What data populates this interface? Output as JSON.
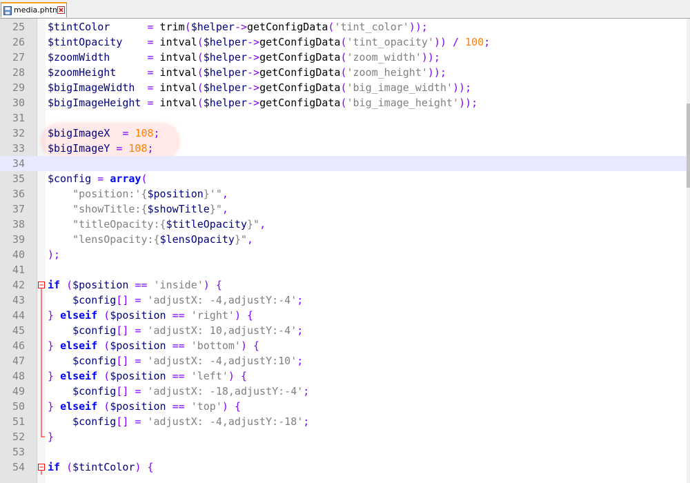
{
  "tab": {
    "filename": "media.phtml",
    "close_icon": "close-x-icon",
    "file_icon": "save-file-icon",
    "accent": "#f4a020"
  },
  "colors": {
    "variable": "#000080",
    "operator": "#8000ff",
    "number": "#ff8000",
    "string": "#808080",
    "keyword": "#0000ff",
    "current_line": "#e8e8ff",
    "gutter": "#e4e4e4",
    "fold_marker": "#ff0000"
  },
  "editor": {
    "current_line_number": "34",
    "lines": [
      {
        "n": "25",
        "tokens": [
          [
            "var",
            "$tintColor"
          ],
          [
            "fn",
            "      "
          ],
          [
            "op",
            "="
          ],
          [
            "fn",
            " trim"
          ],
          [
            "par",
            "("
          ],
          [
            "var",
            "$helper"
          ],
          [
            "op",
            "->"
          ],
          [
            "fn",
            "getConfigData"
          ],
          [
            "par",
            "("
          ],
          [
            "str",
            "'tint_color'"
          ],
          [
            "par",
            "));"
          ]
        ]
      },
      {
        "n": "26",
        "tokens": [
          [
            "var",
            "$tintOpacity"
          ],
          [
            "fn",
            "    "
          ],
          [
            "op",
            "="
          ],
          [
            "fn",
            " intval"
          ],
          [
            "par",
            "("
          ],
          [
            "var",
            "$helper"
          ],
          [
            "op",
            "->"
          ],
          [
            "fn",
            "getConfigData"
          ],
          [
            "par",
            "("
          ],
          [
            "str",
            "'tint_opacity'"
          ],
          [
            "par",
            "))"
          ],
          [
            "fn",
            " "
          ],
          [
            "op",
            "/"
          ],
          [
            "fn",
            " "
          ],
          [
            "num",
            "100"
          ],
          [
            "par",
            ";"
          ]
        ]
      },
      {
        "n": "27",
        "tokens": [
          [
            "var",
            "$zoomWidth"
          ],
          [
            "fn",
            "      "
          ],
          [
            "op",
            "="
          ],
          [
            "fn",
            " intval"
          ],
          [
            "par",
            "("
          ],
          [
            "var",
            "$helper"
          ],
          [
            "op",
            "->"
          ],
          [
            "fn",
            "getConfigData"
          ],
          [
            "par",
            "("
          ],
          [
            "str",
            "'zoom_width'"
          ],
          [
            "par",
            "));"
          ]
        ]
      },
      {
        "n": "28",
        "tokens": [
          [
            "var",
            "$zoomHeight"
          ],
          [
            "fn",
            "     "
          ],
          [
            "op",
            "="
          ],
          [
            "fn",
            " intval"
          ],
          [
            "par",
            "("
          ],
          [
            "var",
            "$helper"
          ],
          [
            "op",
            "->"
          ],
          [
            "fn",
            "getConfigData"
          ],
          [
            "par",
            "("
          ],
          [
            "str",
            "'zoom_height'"
          ],
          [
            "par",
            "));"
          ]
        ]
      },
      {
        "n": "29",
        "tokens": [
          [
            "var",
            "$bigImageWidth"
          ],
          [
            "fn",
            "  "
          ],
          [
            "op",
            "="
          ],
          [
            "fn",
            " intval"
          ],
          [
            "par",
            "("
          ],
          [
            "var",
            "$helper"
          ],
          [
            "op",
            "->"
          ],
          [
            "fn",
            "getConfigData"
          ],
          [
            "par",
            "("
          ],
          [
            "str",
            "'big_image_width'"
          ],
          [
            "par",
            "));"
          ]
        ]
      },
      {
        "n": "30",
        "tokens": [
          [
            "var",
            "$bigImageHeight"
          ],
          [
            "fn",
            " "
          ],
          [
            "op",
            "="
          ],
          [
            "fn",
            " intval"
          ],
          [
            "par",
            "("
          ],
          [
            "var",
            "$helper"
          ],
          [
            "op",
            "->"
          ],
          [
            "fn",
            "getConfigData"
          ],
          [
            "par",
            "("
          ],
          [
            "str",
            "'big_image_height'"
          ],
          [
            "par",
            "));"
          ]
        ]
      },
      {
        "n": "31",
        "tokens": []
      },
      {
        "n": "32",
        "tokens": [
          [
            "var",
            "$bigImageX"
          ],
          [
            "fn",
            "  "
          ],
          [
            "op",
            "="
          ],
          [
            "fn",
            " "
          ],
          [
            "num",
            "108"
          ],
          [
            "par",
            ";"
          ]
        ]
      },
      {
        "n": "33",
        "tokens": [
          [
            "var",
            "$bigImageY"
          ],
          [
            "fn",
            " "
          ],
          [
            "op",
            "="
          ],
          [
            "fn",
            " "
          ],
          [
            "num",
            "108"
          ],
          [
            "par",
            ";"
          ]
        ]
      },
      {
        "n": "34",
        "tokens": []
      },
      {
        "n": "35",
        "tokens": [
          [
            "var",
            "$config"
          ],
          [
            "fn",
            " "
          ],
          [
            "op",
            "="
          ],
          [
            "fn",
            " "
          ],
          [
            "kw",
            "array"
          ],
          [
            "par",
            "("
          ]
        ]
      },
      {
        "n": "36",
        "tokens": [
          [
            "fn",
            "    "
          ],
          [
            "str",
            "\"position:'{"
          ],
          [
            "var",
            "$position"
          ],
          [
            "str",
            "}'\""
          ],
          [
            "par",
            ","
          ]
        ]
      },
      {
        "n": "37",
        "tokens": [
          [
            "fn",
            "    "
          ],
          [
            "str",
            "\"showTitle:{"
          ],
          [
            "var",
            "$showTitle"
          ],
          [
            "str",
            "}\""
          ],
          [
            "par",
            ","
          ]
        ]
      },
      {
        "n": "38",
        "tokens": [
          [
            "fn",
            "    "
          ],
          [
            "str",
            "\"titleOpacity:{"
          ],
          [
            "var",
            "$titleOpacity"
          ],
          [
            "str",
            "}\""
          ],
          [
            "par",
            ","
          ]
        ]
      },
      {
        "n": "39",
        "tokens": [
          [
            "fn",
            "    "
          ],
          [
            "str",
            "\"lensOpacity:{"
          ],
          [
            "var",
            "$lensOpacity"
          ],
          [
            "str",
            "}\""
          ],
          [
            "par",
            ","
          ]
        ]
      },
      {
        "n": "40",
        "tokens": [
          [
            "par",
            ");"
          ]
        ]
      },
      {
        "n": "41",
        "tokens": []
      },
      {
        "n": "42",
        "fold": "box",
        "tokens": [
          [
            "kw",
            "if"
          ],
          [
            "fn",
            " "
          ],
          [
            "par",
            "("
          ],
          [
            "var",
            "$position"
          ],
          [
            "fn",
            " "
          ],
          [
            "op",
            "=="
          ],
          [
            "fn",
            " "
          ],
          [
            "str",
            "'inside'"
          ],
          [
            "par",
            ")"
          ],
          [
            "fn",
            " "
          ],
          [
            "par",
            "{"
          ]
        ]
      },
      {
        "n": "43",
        "fold": "line",
        "tokens": [
          [
            "fn",
            "    "
          ],
          [
            "var",
            "$config"
          ],
          [
            "par",
            "[]"
          ],
          [
            "fn",
            " "
          ],
          [
            "op",
            "="
          ],
          [
            "fn",
            " "
          ],
          [
            "str",
            "'adjustX: -4,adjustY:-4'"
          ],
          [
            "par",
            ";"
          ]
        ]
      },
      {
        "n": "44",
        "fold": "line",
        "tokens": [
          [
            "par",
            "}"
          ],
          [
            "fn",
            " "
          ],
          [
            "kw",
            "elseif"
          ],
          [
            "fn",
            " "
          ],
          [
            "par",
            "("
          ],
          [
            "var",
            "$position"
          ],
          [
            "fn",
            " "
          ],
          [
            "op",
            "=="
          ],
          [
            "fn",
            " "
          ],
          [
            "str",
            "'right'"
          ],
          [
            "par",
            ")"
          ],
          [
            "fn",
            " "
          ],
          [
            "par",
            "{"
          ]
        ]
      },
      {
        "n": "45",
        "fold": "line",
        "tokens": [
          [
            "fn",
            "    "
          ],
          [
            "var",
            "$config"
          ],
          [
            "par",
            "[]"
          ],
          [
            "fn",
            " "
          ],
          [
            "op",
            "="
          ],
          [
            "fn",
            " "
          ],
          [
            "str",
            "'adjustX: 10,adjustY:-4'"
          ],
          [
            "par",
            ";"
          ]
        ]
      },
      {
        "n": "46",
        "fold": "line",
        "tokens": [
          [
            "par",
            "}"
          ],
          [
            "fn",
            " "
          ],
          [
            "kw",
            "elseif"
          ],
          [
            "fn",
            " "
          ],
          [
            "par",
            "("
          ],
          [
            "var",
            "$position"
          ],
          [
            "fn",
            " "
          ],
          [
            "op",
            "=="
          ],
          [
            "fn",
            " "
          ],
          [
            "str",
            "'bottom'"
          ],
          [
            "par",
            ")"
          ],
          [
            "fn",
            " "
          ],
          [
            "par",
            "{"
          ]
        ]
      },
      {
        "n": "47",
        "fold": "line",
        "tokens": [
          [
            "fn",
            "    "
          ],
          [
            "var",
            "$config"
          ],
          [
            "par",
            "[]"
          ],
          [
            "fn",
            " "
          ],
          [
            "op",
            "="
          ],
          [
            "fn",
            " "
          ],
          [
            "str",
            "'adjustX: -4,adjustY:10'"
          ],
          [
            "par",
            ";"
          ]
        ]
      },
      {
        "n": "48",
        "fold": "line",
        "tokens": [
          [
            "par",
            "}"
          ],
          [
            "fn",
            " "
          ],
          [
            "kw",
            "elseif"
          ],
          [
            "fn",
            " "
          ],
          [
            "par",
            "("
          ],
          [
            "var",
            "$position"
          ],
          [
            "fn",
            " "
          ],
          [
            "op",
            "=="
          ],
          [
            "fn",
            " "
          ],
          [
            "str",
            "'left'"
          ],
          [
            "par",
            ")"
          ],
          [
            "fn",
            " "
          ],
          [
            "par",
            "{"
          ]
        ]
      },
      {
        "n": "49",
        "fold": "line",
        "tokens": [
          [
            "fn",
            "    "
          ],
          [
            "var",
            "$config"
          ],
          [
            "par",
            "[]"
          ],
          [
            "fn",
            " "
          ],
          [
            "op",
            "="
          ],
          [
            "fn",
            " "
          ],
          [
            "str",
            "'adjustX: -18,adjustY:-4'"
          ],
          [
            "par",
            ";"
          ]
        ]
      },
      {
        "n": "50",
        "fold": "line",
        "tokens": [
          [
            "par",
            "}"
          ],
          [
            "fn",
            " "
          ],
          [
            "kw",
            "elseif"
          ],
          [
            "fn",
            " "
          ],
          [
            "par",
            "("
          ],
          [
            "var",
            "$position"
          ],
          [
            "fn",
            " "
          ],
          [
            "op",
            "=="
          ],
          [
            "fn",
            " "
          ],
          [
            "str",
            "'top'"
          ],
          [
            "par",
            ")"
          ],
          [
            "fn",
            " "
          ],
          [
            "par",
            "{"
          ]
        ]
      },
      {
        "n": "51",
        "fold": "line",
        "tokens": [
          [
            "fn",
            "    "
          ],
          [
            "var",
            "$config"
          ],
          [
            "par",
            "[]"
          ],
          [
            "fn",
            " "
          ],
          [
            "op",
            "="
          ],
          [
            "fn",
            " "
          ],
          [
            "str",
            "'adjustX: -4,adjustY:-18'"
          ],
          [
            "par",
            ";"
          ]
        ]
      },
      {
        "n": "52",
        "fold": "end",
        "tokens": [
          [
            "par",
            "}"
          ]
        ]
      },
      {
        "n": "53",
        "tokens": []
      },
      {
        "n": "54",
        "fold": "box",
        "tokens": [
          [
            "kw",
            "if"
          ],
          [
            "fn",
            " "
          ],
          [
            "par",
            "("
          ],
          [
            "var",
            "$tintColor"
          ],
          [
            "par",
            ")"
          ],
          [
            "fn",
            " "
          ],
          [
            "par",
            "{"
          ]
        ]
      }
    ]
  }
}
